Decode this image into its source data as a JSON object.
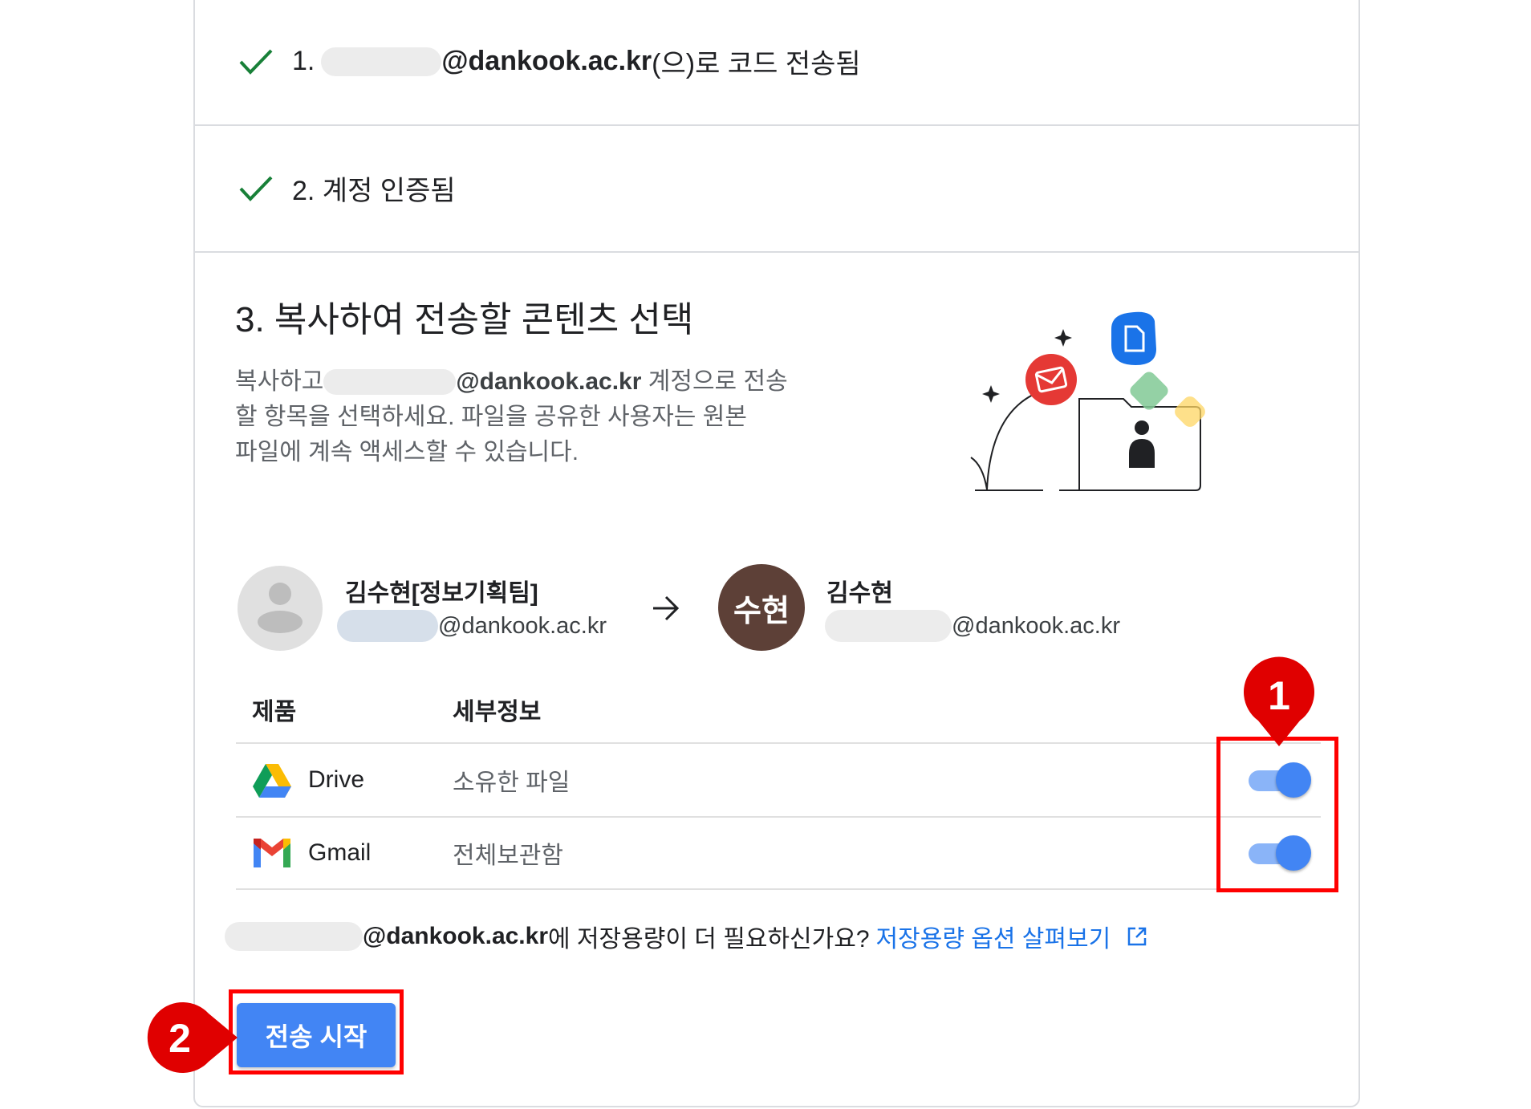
{
  "steps": {
    "step1": {
      "number": "1.",
      "email_domain": "@dankook.ac.kr",
      "suffix": "(으)로 코드 전송됨"
    },
    "step2": {
      "label": "2. 계정 인증됨"
    },
    "step3": {
      "title": "3. 복사하여 전송할 콘텐츠 선택",
      "desc_prefix": "복사하고",
      "desc_domain": "@dankook.ac.kr",
      "desc_line1_rest": " 계정으로 전송",
      "desc_line2": "할 항목을 선택하세요. 파일을 공유한 사용자는 원본",
      "desc_line3": "파일에 계속 액세스할 수 있습니다."
    }
  },
  "source_account": {
    "name": "김수현[정보기획팀]",
    "email_domain": "@dankook.ac.kr"
  },
  "target_account": {
    "avatar_text": "수현",
    "avatar_color": "#5d4037",
    "name": "김수현",
    "email_domain": "@dankook.ac.kr"
  },
  "table": {
    "headers": {
      "product": "제품",
      "details": "세부정보"
    },
    "rows": [
      {
        "icon": "google-drive-icon",
        "product": "Drive",
        "details": "소유한 파일",
        "enabled": true
      },
      {
        "icon": "gmail-icon",
        "product": "Gmail",
        "details": "전체보관함",
        "enabled": true
      }
    ]
  },
  "storage": {
    "domain": "@dankook.ac.kr",
    "question": "에 저장용량이 더 필요하신가요?",
    "link_text": "저장용량 옵션 살펴보기",
    "link_icon": "open-in-new-icon"
  },
  "start_button": {
    "label": "전송 시작"
  },
  "annotations": {
    "badge1": "1",
    "badge2": "2",
    "highlight_color": "#ff0000"
  },
  "colors": {
    "accent": "#4285f4",
    "check": "#188038",
    "link": "#1a73e8"
  }
}
